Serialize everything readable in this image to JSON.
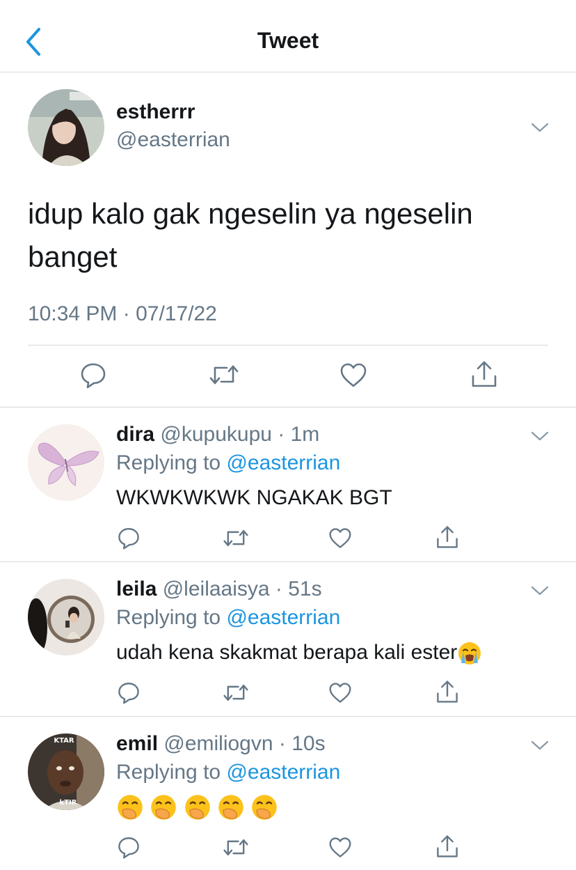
{
  "header": {
    "title": "Tweet",
    "back_icon": "chevron-left-icon"
  },
  "colors": {
    "link": "#1b95e0",
    "secondary_text": "#657786",
    "divider": "#d6d9dc",
    "icon": "#657786"
  },
  "main_tweet": {
    "name": "estherrr",
    "handle": "@easterrian",
    "text": "idup kalo gak ngeselin ya ngeselin banget",
    "timestamp": "10:34 PM · 07/17/22",
    "menu_icon": "chevron-down-icon",
    "actions": [
      "reply-icon",
      "retweet-icon",
      "like-icon",
      "share-icon"
    ]
  },
  "replies": [
    {
      "name": "dira",
      "meta": "@kupukupu · 1m",
      "replying_label": "Replying to ",
      "replying_handle": "@easterrian",
      "text": "WKWKWKWK NGAKAK BGT",
      "avatar": "butterfly"
    },
    {
      "name": "leila",
      "meta": "@leilaaisya · 51s",
      "replying_label": "Replying to ",
      "replying_handle": "@easterrian",
      "text": "udah kena skakmat berapa kali ester",
      "emoji": "loudly-crying-face",
      "avatar": "mirror"
    },
    {
      "name": "emil",
      "meta": "@emiliogvn · 10s",
      "replying_label": "Replying to ",
      "replying_handle": "@easterrian",
      "text": "",
      "emoji": "face-with-hand-over-mouth",
      "emoji_count": 5,
      "avatar": "face",
      "avatar_captions": [
        "KTAR",
        "kTIR"
      ]
    }
  ]
}
